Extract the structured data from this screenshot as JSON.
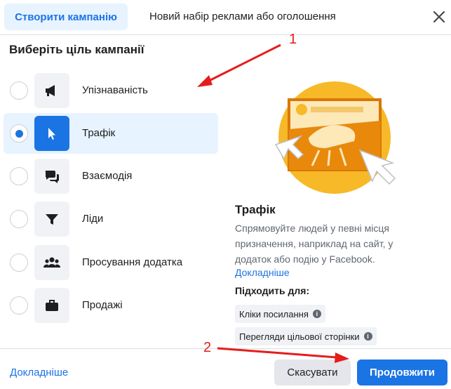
{
  "header": {
    "active_tab": "Створити кампанію",
    "inactive_tab": "Новий набір реклами або оголошення"
  },
  "section_title": "Виберіть ціль кампанії",
  "objectives": [
    {
      "label": "Упізнаваність",
      "icon": "megaphone-icon",
      "selected": false
    },
    {
      "label": "Трафік",
      "icon": "cursor-icon",
      "selected": true
    },
    {
      "label": "Взаємодія",
      "icon": "chat-bubbles-icon",
      "selected": false
    },
    {
      "label": "Ліди",
      "icon": "funnel-icon",
      "selected": false
    },
    {
      "label": "Просування додатка",
      "icon": "people-icon",
      "selected": false
    },
    {
      "label": "Продажі",
      "icon": "briefcase-icon",
      "selected": false
    }
  ],
  "detail": {
    "title": "Трафік",
    "description": "Спрямовуйте людей у певні місця призначення, наприклад на сайт, у додаток або подію у Facebook.",
    "learn_more": "Докладніше",
    "suits_label": "Підходить для:",
    "chips": [
      "Кліки посилання",
      "Перегляди цільової сторінки"
    ]
  },
  "footer": {
    "learn_more": "Докладніше",
    "cancel": "Скасувати",
    "continue": "Продовжити"
  },
  "annotations": [
    "1",
    "2"
  ],
  "colors": {
    "accent": "#1b74e4",
    "selected_bg": "#e7f3ff",
    "annotation_red": "#e51d1d",
    "illustration_yellow": "#f7b928",
    "illustration_orange": "#e8890c"
  }
}
